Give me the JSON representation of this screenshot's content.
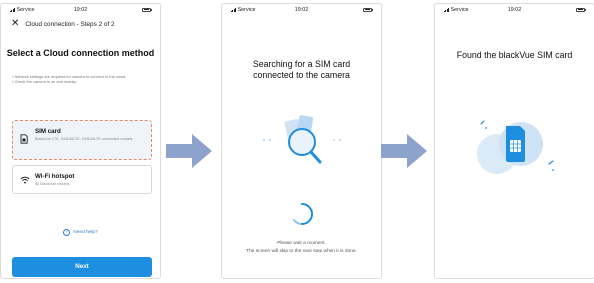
{
  "status": {
    "carrier": "Service",
    "time": "19:02"
  },
  "screen1": {
    "header_title": "Cloud connection - Steps 2 of 2",
    "title": "Select a Cloud connection method",
    "notes": [
      "Network settings are required for camera to connect to the cloud.",
      "Check the camera is on and nearby."
    ],
    "options": [
      {
        "title": "SIM card",
        "subtitle": "BlackVue LTE, CM100LTE, CM100LTE connected models",
        "icon": "sim-card-icon",
        "selected": true
      },
      {
        "title": "Wi-Fi hotspot",
        "subtitle": "All BlackVue models",
        "icon": "wifi-icon",
        "selected": false
      }
    ],
    "need_help": "Need help?",
    "next_button": "Next"
  },
  "screen2": {
    "title_line1": "Searching for a SIM card",
    "title_line2": "connected to the camera",
    "wait_line1": "Please wait a moment.",
    "wait_line2": "The screen will skip to the next step when it is done."
  },
  "screen3": {
    "title": "Found the blackVue SIM card"
  },
  "colors": {
    "accent": "#1d8ee0",
    "arrow": "#8ea3cc",
    "selection_border": "#e98a63",
    "selected_bg": "#eef4fa"
  }
}
